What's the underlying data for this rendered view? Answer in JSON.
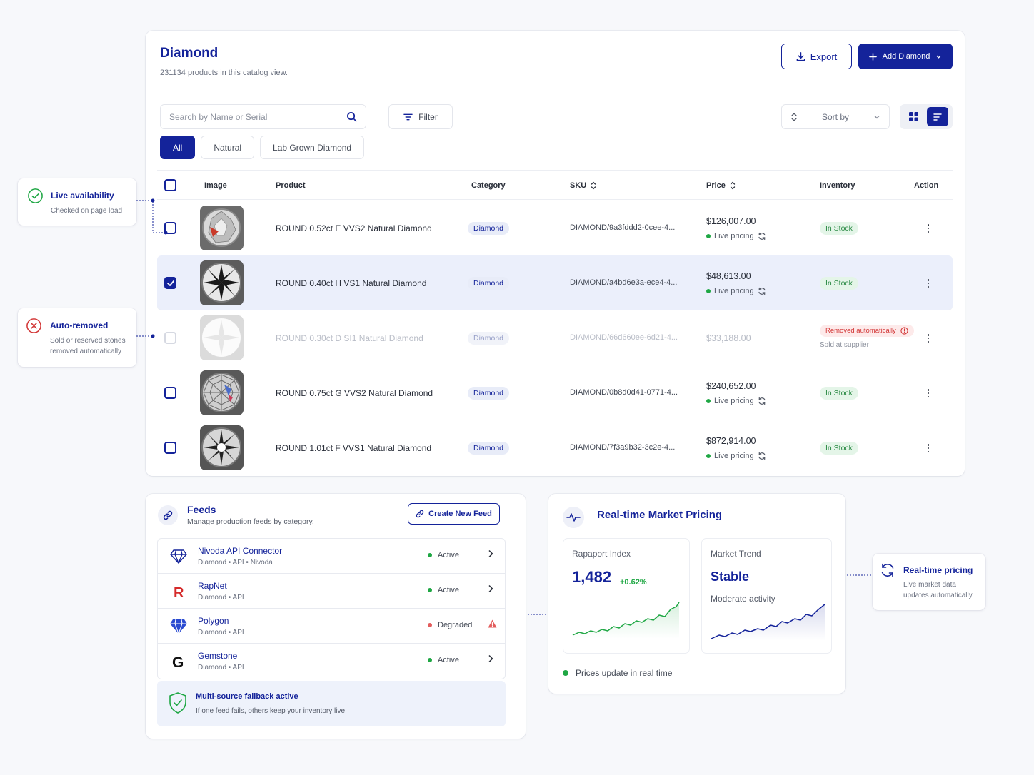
{
  "header": {
    "title": "Diamond",
    "subtitle": "231134 products in this catalog view.",
    "export_label": "Export",
    "add_label": "Add Diamond"
  },
  "toolbar": {
    "search_placeholder": "Search by Name or Serial",
    "filter_label": "Filter",
    "sort_label": "Sort by"
  },
  "tabs": [
    {
      "label": "All",
      "active": true
    },
    {
      "label": "Natural",
      "active": false
    },
    {
      "label": "Lab Grown Diamond",
      "active": false
    }
  ],
  "table": {
    "columns": [
      "Image",
      "Product",
      "Category",
      "SKU",
      "Price",
      "Inventory",
      "Action"
    ],
    "rows": [
      {
        "product": "ROUND 0.52ct E VVS2 Natural Diamond",
        "category": "Diamond",
        "sku": "DIAMOND/9a3fddd2-0cee-4...",
        "price": "$126,007.00",
        "live": "Live pricing",
        "inventory": "In Stock",
        "checked": false
      },
      {
        "product": "ROUND 0.40ct H VS1 Natural Diamond",
        "category": "Diamond",
        "sku": "DIAMOND/a4bd6e3a-ece4-4...",
        "price": "$48,613.00",
        "live": "Live pricing",
        "inventory": "In Stock",
        "checked": true
      },
      {
        "product": "ROUND 0.30ct D SI1 Natural Diamond",
        "category": "Diamond",
        "sku": "DIAMOND/66d660ee-6d21-4...",
        "price": "$33,188.00",
        "inventory": "Removed automatically",
        "inventory_sub": "Sold at supplier",
        "checked": false
      },
      {
        "product": "ROUND 0.75ct G VVS2 Natural Diamond",
        "category": "Diamond",
        "sku": "DIAMOND/0b8d0d41-0771-4...",
        "price": "$240,652.00",
        "live": "Live pricing",
        "inventory": "In Stock",
        "checked": false
      },
      {
        "product": "ROUND 1.01ct F VVS1 Natural Diamond",
        "category": "Diamond",
        "sku": "DIAMOND/7f3a9b32-3c2e-4...",
        "price": "$872,914.00",
        "live": "Live pricing",
        "inventory": "In Stock",
        "checked": false
      }
    ]
  },
  "callouts": {
    "live_availability": {
      "title": "Live availability",
      "sub": "Checked on page load"
    },
    "auto_removed": {
      "title": "Auto-removed",
      "sub1": "Sold or reserved stones",
      "sub2": "removed automatically"
    },
    "realtime_pricing": {
      "title": "Real-time pricing",
      "sub1": "Live market data",
      "sub2": "updates automatically"
    }
  },
  "feeds": {
    "title": "Feeds",
    "subtitle": "Manage production feeds by category.",
    "create_label": "Create New Feed",
    "items": [
      {
        "name": "Nivoda API Connector",
        "meta": "Diamond  •  API  •  Nivoda",
        "status": "Active",
        "status_color": "#1fa744"
      },
      {
        "name": "RapNet",
        "meta": "Diamond  •  API",
        "status": "Active",
        "status_color": "#1fa744"
      },
      {
        "name": "Polygon",
        "meta": "Diamond  •  API",
        "status": "Degraded",
        "status_color": "#e35d5d"
      },
      {
        "name": "Gemstone",
        "meta": "Diamond  •  API",
        "status": "Active",
        "status_color": "#1fa744"
      }
    ],
    "fallback_title": "Multi-source fallback active",
    "fallback_sub": "If one feed fails, others keep your inventory live"
  },
  "market": {
    "title": "Real-time Market Pricing",
    "rapaport_label": "Rapaport Index",
    "rapaport_value": "1,482",
    "rapaport_change": "+0.62%",
    "trend_label": "Market Trend",
    "trend_value": "Stable",
    "trend_sub": "Moderate activity",
    "footer": "Prices update in real time"
  },
  "colors": {
    "brand": "#14239a",
    "success": "#1fa744",
    "danger": "#d23636"
  }
}
